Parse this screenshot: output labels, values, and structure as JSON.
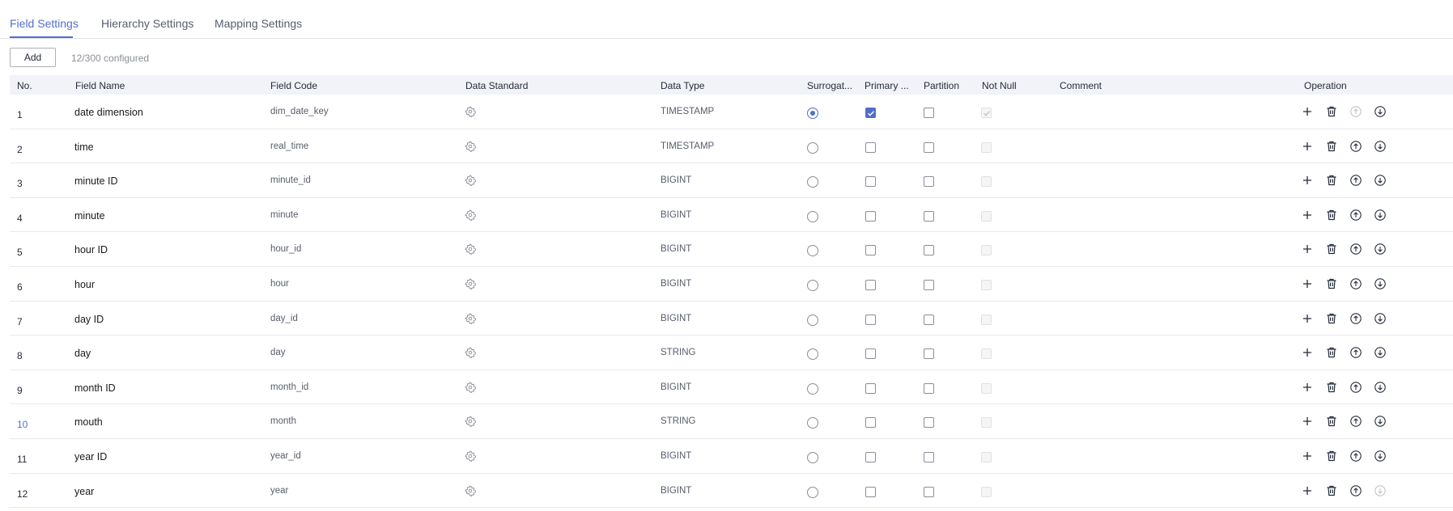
{
  "tabs": [
    {
      "label": "Field Settings",
      "active": true
    },
    {
      "label": "Hierarchy Settings",
      "active": false
    },
    {
      "label": "Mapping Settings",
      "active": false
    }
  ],
  "toolbar": {
    "add_label": "Add",
    "configured": "12/300 configured"
  },
  "columns": {
    "no": "No.",
    "field_name": "Field Name",
    "field_code": "Field Code",
    "data_standard": "Data Standard",
    "data_type": "Data Type",
    "surrogate": "Surrogat...",
    "primary": "Primary ...",
    "partition": "Partition",
    "not_null": "Not Null",
    "comment": "Comment",
    "operation": "Operation"
  },
  "rows": [
    {
      "no": "1",
      "name": "date dimension",
      "code": "dim_date_key",
      "type": "TIMESTAMP",
      "surrogate": true,
      "primary": true,
      "partition": false,
      "not_null": true
    },
    {
      "no": "2",
      "name": "time",
      "code": "real_time",
      "type": "TIMESTAMP",
      "surrogate": false,
      "primary": false,
      "partition": false,
      "not_null": false
    },
    {
      "no": "3",
      "name": "minute  ID",
      "code": "minute_id",
      "type": "BIGINT",
      "surrogate": false,
      "primary": false,
      "partition": false,
      "not_null": false
    },
    {
      "no": "4",
      "name": "minute",
      "code": "minute",
      "type": "BIGINT",
      "surrogate": false,
      "primary": false,
      "partition": false,
      "not_null": false
    },
    {
      "no": "5",
      "name": "hour ID",
      "code": "hour_id",
      "type": "BIGINT",
      "surrogate": false,
      "primary": false,
      "partition": false,
      "not_null": false
    },
    {
      "no": "6",
      "name": "hour",
      "code": "hour",
      "type": "BIGINT",
      "surrogate": false,
      "primary": false,
      "partition": false,
      "not_null": false
    },
    {
      "no": "7",
      "name": "day ID",
      "code": "day_id",
      "type": "BIGINT",
      "surrogate": false,
      "primary": false,
      "partition": false,
      "not_null": false
    },
    {
      "no": "8",
      "name": "day",
      "code": "day",
      "type": "STRING",
      "surrogate": false,
      "primary": false,
      "partition": false,
      "not_null": false
    },
    {
      "no": "9",
      "name": "month ID",
      "code": "month_id",
      "type": "BIGINT",
      "surrogate": false,
      "primary": false,
      "partition": false,
      "not_null": false
    },
    {
      "no": "10",
      "name": "mouth",
      "code": "month",
      "type": "STRING",
      "surrogate": false,
      "primary": false,
      "partition": false,
      "not_null": false
    },
    {
      "no": "11",
      "name": "year ID",
      "code": "year_id",
      "type": "BIGINT",
      "surrogate": false,
      "primary": false,
      "partition": false,
      "not_null": false
    },
    {
      "no": "12",
      "name": "year",
      "code": "year",
      "type": "BIGINT",
      "surrogate": false,
      "primary": false,
      "partition": false,
      "not_null": false
    }
  ],
  "icons": {
    "data_standard": "gear-icon",
    "add": "plus-icon",
    "delete": "trash-icon",
    "move_up": "arrow-up-circle-icon",
    "move_down": "arrow-down-circle-icon"
  },
  "colors": {
    "accent": "#526ecc",
    "border": "#e8e9ed",
    "header_bg": "#f1f3f8",
    "disabled": "#c2c4c9"
  }
}
